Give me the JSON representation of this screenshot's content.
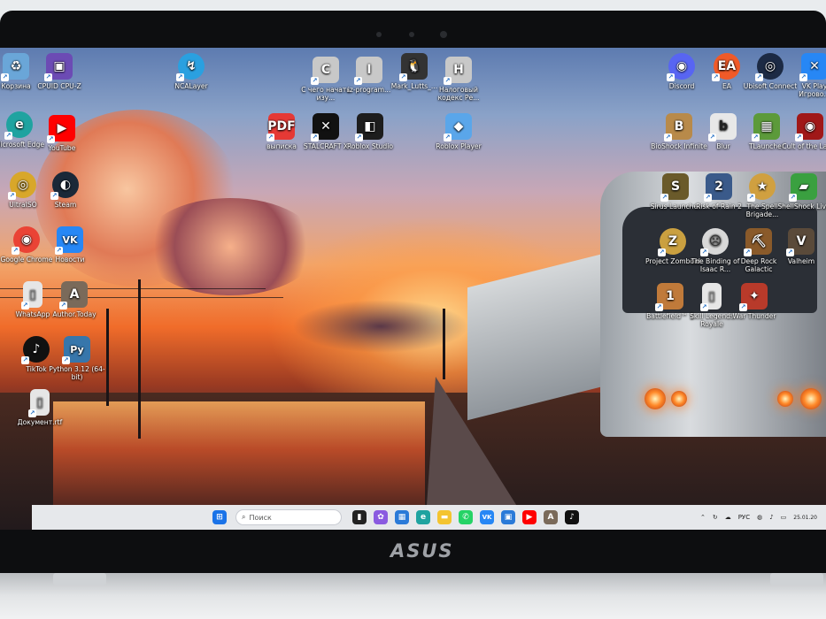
{
  "desktop": {
    "icons": [
      {
        "id": "recycle-bin",
        "label": "Корзина",
        "icon": "recycle-bin-icon",
        "color": "#6aa6d8",
        "glyph": "♻"
      },
      {
        "id": "cpuid",
        "label": "CPUID CPU-Z",
        "icon": "chip-icon",
        "color": "#6c4bb4",
        "glyph": "▣"
      },
      {
        "id": "ncalayer",
        "label": "NCALayer",
        "icon": "ncalayer-icon",
        "color": "#2aa0e0",
        "glyph": "↯"
      },
      {
        "id": "doc-c",
        "label": "С чего начать изу...",
        "icon": "document-icon",
        "color": "#c8c8c8",
        "glyph": "C"
      },
      {
        "id": "doc-i",
        "label": "iz-program...",
        "icon": "document-icon",
        "color": "#c8c8c8",
        "glyph": "I"
      },
      {
        "id": "mark-lutts",
        "label": "Mark_Lutts_...",
        "icon": "penguin-icon",
        "color": "#333333",
        "glyph": "🐧"
      },
      {
        "id": "doc-h",
        "label": "Налоговый кодекс Ре...",
        "icon": "document-icon",
        "color": "#c8c8c8",
        "glyph": "H"
      },
      {
        "id": "discord",
        "label": "Discord",
        "icon": "discord-icon",
        "color": "#5865f2",
        "glyph": "◉"
      },
      {
        "id": "ea",
        "label": "EA",
        "icon": "ea-icon",
        "color": "#f05a28",
        "glyph": "EA"
      },
      {
        "id": "ubisoft",
        "label": "Ubisoft Connect",
        "icon": "ubisoft-icon",
        "color": "#1c2a44",
        "glyph": "◎"
      },
      {
        "id": "vkplay",
        "label": "VK Play Игрово...",
        "icon": "vkplay-icon",
        "color": "#2787f5",
        "glyph": "✕"
      },
      {
        "id": "edge",
        "label": "Microsoft Edge",
        "icon": "edge-icon",
        "color": "#1fa3a0",
        "glyph": "e"
      },
      {
        "id": "youtube",
        "label": "YouTube",
        "icon": "youtube-icon",
        "color": "#ff0000",
        "glyph": "▶"
      },
      {
        "id": "pdf",
        "label": "выписка",
        "icon": "pdf-icon",
        "color": "#e53935",
        "glyph": "PDF"
      },
      {
        "id": "stalcraft",
        "label": "STALCRAFT X",
        "icon": "stalcraft-icon",
        "color": "#111111",
        "glyph": "✕"
      },
      {
        "id": "roblox-studio",
        "label": "Roblox Studio",
        "icon": "roblox-studio-icon",
        "color": "#1d1d1d",
        "glyph": "◧"
      },
      {
        "id": "roblox-player",
        "label": "Roblox Player",
        "icon": "roblox-icon",
        "color": "#5aa6ea",
        "glyph": "◆"
      },
      {
        "id": "bioshock",
        "label": "BioShock Infinite",
        "icon": "bioshock-icon",
        "color": "#b88a4a",
        "glyph": "B"
      },
      {
        "id": "blur",
        "label": "Blur",
        "icon": "blur-icon",
        "color": "#e8e8e8",
        "glyph": "b"
      },
      {
        "id": "tlauncher",
        "label": "TLauncher",
        "icon": "grass-block-icon",
        "color": "#5c9a3a",
        "glyph": "▦"
      },
      {
        "id": "cult-lamb",
        "label": "Cult of the Lamb",
        "icon": "cult-lamb-icon",
        "color": "#a01818",
        "glyph": "◉"
      },
      {
        "id": "ultraiso",
        "label": "UltraISO",
        "icon": "disc-icon",
        "color": "#d8a72a",
        "glyph": "◎"
      },
      {
        "id": "steam",
        "label": "Steam",
        "icon": "steam-icon",
        "color": "#1b2838",
        "glyph": "◐"
      },
      {
        "id": "sirus",
        "label": "Sirus Launcher",
        "icon": "sirus-icon",
        "color": "#6a5a2a",
        "glyph": "S"
      },
      {
        "id": "ror2",
        "label": "Risk of Rain 2",
        "icon": "ror2-icon",
        "color": "#3a5a8a",
        "glyph": "2"
      },
      {
        "id": "spell-brigade",
        "label": "The Spell Brigade...",
        "icon": "spell-brigade-icon",
        "color": "#d0a040",
        "glyph": "★"
      },
      {
        "id": "shellshock",
        "label": "ShellShock Live",
        "icon": "tank-icon",
        "color": "#3aa040",
        "glyph": "▰"
      },
      {
        "id": "chrome",
        "label": "Google Chrome",
        "icon": "chrome-icon",
        "color": "#ea4335",
        "glyph": "◉"
      },
      {
        "id": "vk",
        "label": "Новости",
        "icon": "vk-icon",
        "color": "#2787f5",
        "glyph": "VK"
      },
      {
        "id": "zomboid",
        "label": "Project Zomboid",
        "icon": "zomboid-icon",
        "color": "#caa040",
        "glyph": "Z"
      },
      {
        "id": "isaac",
        "label": "The Binding of Isaac R...",
        "icon": "isaac-icon",
        "color": "#d8d8d8",
        "glyph": "☹"
      },
      {
        "id": "deep-rock",
        "label": "Deep Rock Galactic",
        "icon": "deep-rock-icon",
        "color": "#8a5a2a",
        "glyph": "⛏"
      },
      {
        "id": "valheim",
        "label": "Valheim",
        "icon": "valheim-icon",
        "color": "#5a4a3a",
        "glyph": "V"
      },
      {
        "id": "whatsapp-file",
        "label": "WhatsApp",
        "icon": "file-icon",
        "color": "#e6e6e6",
        "glyph": "▯"
      },
      {
        "id": "author-today",
        "label": "Author.Today",
        "icon": "author-today-icon",
        "color": "#7a6a5a",
        "glyph": "A"
      },
      {
        "id": "battlefield",
        "label": "Battlefield™ 1",
        "icon": "battlefield-icon",
        "color": "#c07a3a",
        "glyph": "1"
      },
      {
        "id": "skill-legends",
        "label": "Skill Legends Royale",
        "icon": "file-icon",
        "color": "#e6e6e6",
        "glyph": "▯"
      },
      {
        "id": "war-thunder",
        "label": "War Thunder",
        "icon": "war-thunder-icon",
        "color": "#b83a2a",
        "glyph": "✦"
      },
      {
        "id": "tiktok",
        "label": "TikTok",
        "icon": "tiktok-icon",
        "color": "#111111",
        "glyph": "♪"
      },
      {
        "id": "python",
        "label": "Python 3.12 (64-bit)",
        "icon": "python-icon",
        "color": "#3776ab",
        "glyph": "Py"
      },
      {
        "id": "document-rtf",
        "label": "Документ.rtf",
        "icon": "file-icon",
        "color": "#e6e6e6",
        "glyph": "▯"
      }
    ]
  },
  "taskbar": {
    "search_placeholder": "Поиск",
    "pinned": [
      {
        "id": "start",
        "icon": "windows-icon",
        "color": "#1a73e8",
        "glyph": "⊞"
      },
      {
        "id": "task-view",
        "icon": "task-view-icon",
        "color": "#222222",
        "glyph": "▮"
      },
      {
        "id": "copilot",
        "icon": "copilot-icon",
        "color": "#8a5ae0",
        "glyph": "✿"
      },
      {
        "id": "widgets",
        "icon": "widgets-icon",
        "color": "#2a7ad8",
        "glyph": "▦"
      },
      {
        "id": "edge",
        "icon": "edge-icon",
        "color": "#1fa3a0",
        "glyph": "e"
      },
      {
        "id": "explorer",
        "icon": "folder-icon",
        "color": "#f4c430",
        "glyph": "▬"
      },
      {
        "id": "whatsapp",
        "icon": "whatsapp-icon",
        "color": "#25d366",
        "glyph": "✆"
      },
      {
        "id": "vk",
        "icon": "vk-icon",
        "color": "#2787f5",
        "glyph": "VK"
      },
      {
        "id": "store",
        "icon": "store-icon",
        "color": "#2a7ad8",
        "glyph": "▣"
      },
      {
        "id": "youtube",
        "icon": "youtube-icon",
        "color": "#ff0000",
        "glyph": "▶"
      },
      {
        "id": "author-today",
        "icon": "author-today-icon",
        "color": "#7a6a5a",
        "glyph": "A"
      },
      {
        "id": "tiktok",
        "icon": "tiktok-icon",
        "color": "#111111",
        "glyph": "♪"
      }
    ],
    "tray": {
      "language": "РУС",
      "date": "25.01.20"
    }
  },
  "laptop": {
    "brand": "ASUS"
  }
}
